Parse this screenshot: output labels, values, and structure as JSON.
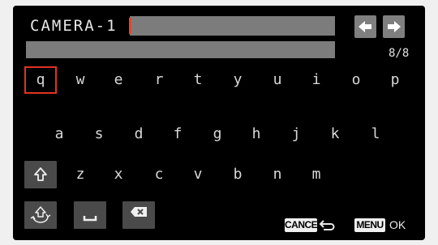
{
  "input": {
    "text": "CAMERA-1",
    "counter": "8/8"
  },
  "cursor_nav": {
    "left_icon": "left-arrow-icon",
    "right_icon": "right-arrow-icon"
  },
  "keyboard": {
    "row1": [
      "q",
      "w",
      "e",
      "r",
      "t",
      "y",
      "u",
      "i",
      "o",
      "p"
    ],
    "row2": [
      "a",
      "s",
      "d",
      "f",
      "g",
      "h",
      "j",
      "k",
      "l"
    ],
    "row3": [
      "z",
      "x",
      "c",
      "v",
      "b",
      "n",
      "m"
    ],
    "selected_key": "q",
    "shift_icon": "shift-icon",
    "mode_icon": "character-mode-icon",
    "space_icon": "space-icon",
    "delete_icon": "backspace-icon"
  },
  "footer": {
    "cancel_label": "CANCEL",
    "cancel_icon": "return-icon",
    "menu_label": "MENU",
    "ok_label": "OK"
  },
  "colors": {
    "selection": "#e23222",
    "cursor": "#e8442a",
    "field": "#7c7c7c",
    "function_key": "#4a4a4a"
  }
}
